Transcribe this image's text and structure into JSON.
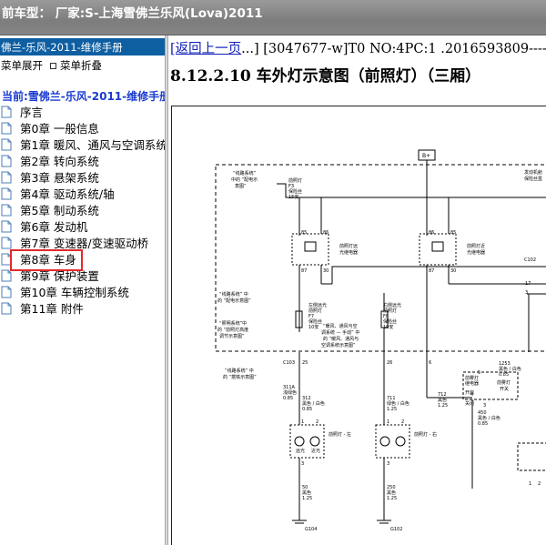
{
  "window": {
    "title": "前车型：  厂家:S-上海雪佛兰乐风(Lova)2011"
  },
  "sidebar": {
    "header": "佛兰-乐风-2011-维修手册",
    "expand_label": "菜单展开",
    "collapse_label": "菜单折叠",
    "current": "当前:雪佛兰-乐风-2011-维修手册",
    "items": [
      {
        "label": "序言"
      },
      {
        "label": "第0章 一般信息"
      },
      {
        "label": "第1章 暖风、通风与空调系统"
      },
      {
        "label": "第2章 转向系统"
      },
      {
        "label": "第3章 悬架系统"
      },
      {
        "label": "第4章 驱动系统/轴"
      },
      {
        "label": "第5章 制动系统"
      },
      {
        "label": "第6章 发动机"
      },
      {
        "label": "第7章 变速器/变速驱动桥"
      },
      {
        "label": "第8章 车身",
        "selected": true
      },
      {
        "label": "第9章 保护装置"
      },
      {
        "label": "第10章 车辆控制系统"
      },
      {
        "label": "第11章 附件"
      }
    ]
  },
  "content": {
    "back_link": "[返回上一页",
    "meta": "...] [3047677-w]T0 NO:4PC:1 .2016593809-----...",
    "heading": "8.12.2.10 车外灯示意图（前照灯）（三厢）"
  },
  "diagram": {
    "labels": {
      "bplus": "B+",
      "fuse_box_note_1": "“线路系统”",
      "fuse_box_note_2": "中的 “配电示",
      "fuse_box_note_3": "意图”",
      "fuse_f3_1": "前照灯",
      "fuse_f3_2": "F3",
      "fuse_f3_3": "保险丝",
      "fuse_f3_4": "15安",
      "relay_left_1": "前照灯远",
      "relay_left_2": "光继电器",
      "relay_right_1": "前照灯近",
      "relay_right_2": "光继电器",
      "engine_box_1": "发动机舱",
      "engine_box_2": "保险丝盒",
      "c102": "C102",
      "c103": "C103",
      "left_fuse_1": "左侧远光",
      "left_fuse_2": "前照灯",
      "left_fuse_3": "F7",
      "left_fuse_4": "保险丝",
      "left_fuse_5": "10安",
      "right_fuse_1": "右侧远光",
      "right_fuse_2": "前照灯",
      "right_fuse_3": "F8",
      "right_fuse_4": "保险丝",
      "right_fuse_5": "10安",
      "note_lighting_1": "“照明系统”中",
      "note_lighting_2": "的 “前照灯高度",
      "note_lighting_3": "调节示意图”",
      "note_line_1": "“线路系统” 中",
      "note_line_2": "的 “配电示意图”",
      "note_hvac_1": "“暖风、通风与空",
      "note_hvac_2": "调系统 — 手动” 中",
      "note_hvac_3": "的 “暖风、通风与",
      "note_hvac_4": "空调系统示意图”",
      "note_ground_1": "“线路系统” 中",
      "note_ground_2": "的 “搭铁示意图”",
      "w311a_1": "311A",
      "w311a_2": "浅绿色",
      "w311a_3": "0.85",
      "w312_1": "312",
      "w312_2": "黑色 / 白色",
      "w312_3": "0.85",
      "w711_1": "711",
      "w711_2": "绿色 / 白色",
      "w711_3": "1.25",
      "w712_1": "712",
      "w712_2": "黑色",
      "w712_3": "1.25",
      "w1253_1": "1253",
      "w1253_2": "黑色 / 白色",
      "w1253_3": "0.85",
      "w450_1": "450",
      "w450_2": "黑色 / 白色",
      "w450_3": "0.85",
      "w50_1": "50",
      "w50_2": "黑色",
      "w50_3": "1.25",
      "w250_1": "250",
      "w250_2": "黑色",
      "w250_3": "1.25",
      "lamp_left": "前照灯 - 左",
      "lamp_right": "前照灯 - 右",
      "fog_switch_1": "前雾灯",
      "fog_switch_2": "开关",
      "fog_relay_1": "前雾灯",
      "fog_relay_2": "继电器",
      "on": "开启",
      "off": "关闭",
      "lamp_hi": "远光",
      "lamp_lo": "近光",
      "g104": "G104",
      "g102": "G102",
      "pin_85": "85",
      "pin_86": "86",
      "pin_87": "87",
      "pin_30": "30",
      "pin_86b": "86",
      "pin_85b": "85",
      "pin_87b": "87",
      "pin_30b": "30",
      "c102_17": "17",
      "c102_3": "3",
      "c103_25": "25",
      "c103_26": "26",
      "c103_6": "6",
      "lamp_pin1": "1",
      "lamp_pin2": "2",
      "lamp_pin3": "3",
      "lamp_pin1r": "1",
      "lamp_pin2r": "2",
      "lamp_pin3r": "3",
      "fog_pin5": "5",
      "fog_pin4": "4",
      "fog_pin3": "3",
      "pin_x1": "1",
      "pin_x2": "2",
      "pin_x3": "3",
      "pin_b": "B",
      "pin_5": "5",
      "pin_6": "6",
      "pin_10": "10",
      "pin_11": "11"
    }
  }
}
